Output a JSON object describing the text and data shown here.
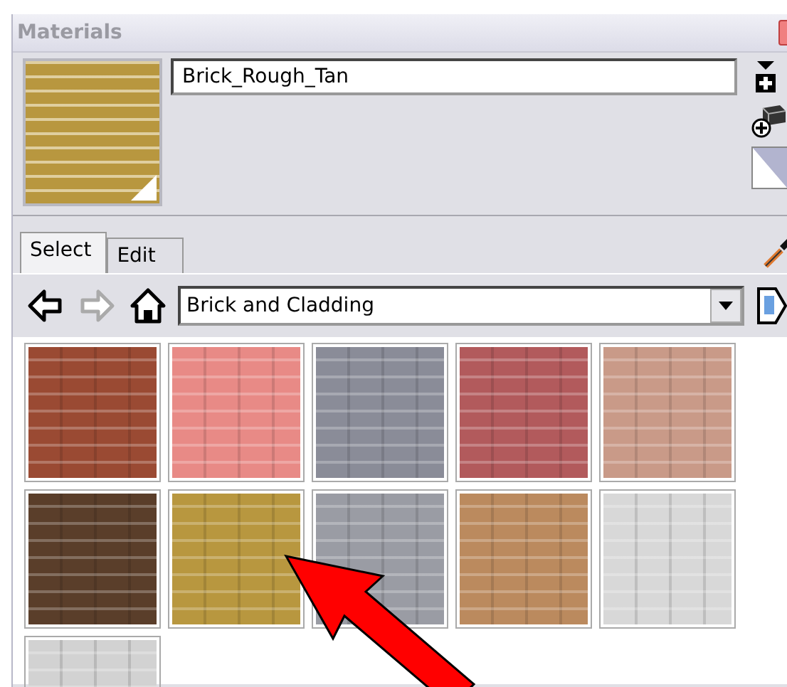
{
  "window": {
    "title": "Materials"
  },
  "preview": {
    "color": "#b8973f"
  },
  "name_field": {
    "value": "Brick_Rough_Tan"
  },
  "tabs": [
    {
      "label": "Select",
      "selected": true
    },
    {
      "label": "Edit",
      "selected": false
    }
  ],
  "nav": {
    "back": {
      "disabled": false
    },
    "forward": {
      "disabled": true
    }
  },
  "library_dropdown": {
    "value": "Brick and Cladding"
  },
  "materials": [
    {
      "color": "#9a4a33"
    },
    {
      "color": "#e88a86"
    },
    {
      "color": "#8a8c98"
    },
    {
      "color": "#b25a5c"
    },
    {
      "color": "#c99a88"
    },
    {
      "color": "#5a3e2a"
    },
    {
      "color": "#b8973f"
    },
    {
      "color": "#9a9ca4"
    },
    {
      "color": "#bb8a5e"
    },
    {
      "color": "#d8d8d8"
    },
    {
      "color": "#d2d2d2"
    }
  ]
}
